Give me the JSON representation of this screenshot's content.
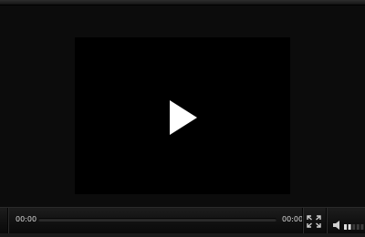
{
  "player": {
    "current_time": "00:00",
    "duration": "00:00",
    "progress": 0,
    "volume_level": 0.4,
    "icons": {
      "play": "play-icon",
      "fullscreen": "fullscreen-icon",
      "volume": "volume-icon"
    },
    "colors": {
      "background": "#0b0b0b",
      "control_bar": "#141414",
      "text": "#d8d8d8",
      "play_icon": "#ffffff"
    }
  }
}
